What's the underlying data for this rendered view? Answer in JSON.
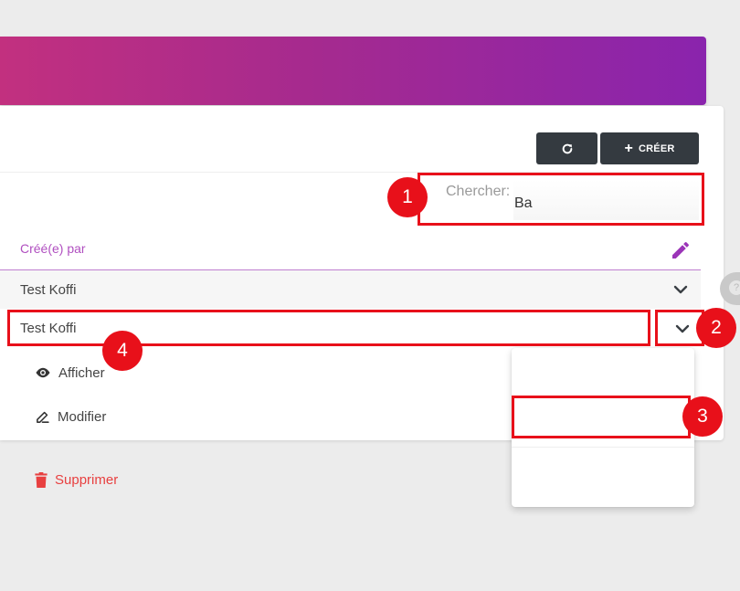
{
  "toolbar": {
    "refresh_icon": "refresh-icon",
    "create_label": "CRÉER"
  },
  "search": {
    "label": "Chercher:",
    "value": "Ba"
  },
  "table": {
    "column_header": "Créé(e) par",
    "rows": [
      {
        "created_by": "Test Koffi"
      },
      {
        "created_by": "Test Koffi"
      }
    ]
  },
  "dropdown_menu": {
    "items": [
      {
        "label": "Afficher",
        "icon": "eye-icon"
      },
      {
        "label": "Modifier",
        "icon": "pencil-icon"
      },
      {
        "label": "Supprimer",
        "icon": "trash-icon",
        "color": "#e84040"
      }
    ]
  },
  "annotations": {
    "badges": [
      "1",
      "2",
      "3",
      "4"
    ],
    "highlight_color": "#e8101a"
  },
  "colors": {
    "banner_gradient": [
      "#c2307f",
      "#8a24ad"
    ],
    "accent": "#b04fc0",
    "button_dark": "#343a40",
    "danger": "#e84040"
  }
}
